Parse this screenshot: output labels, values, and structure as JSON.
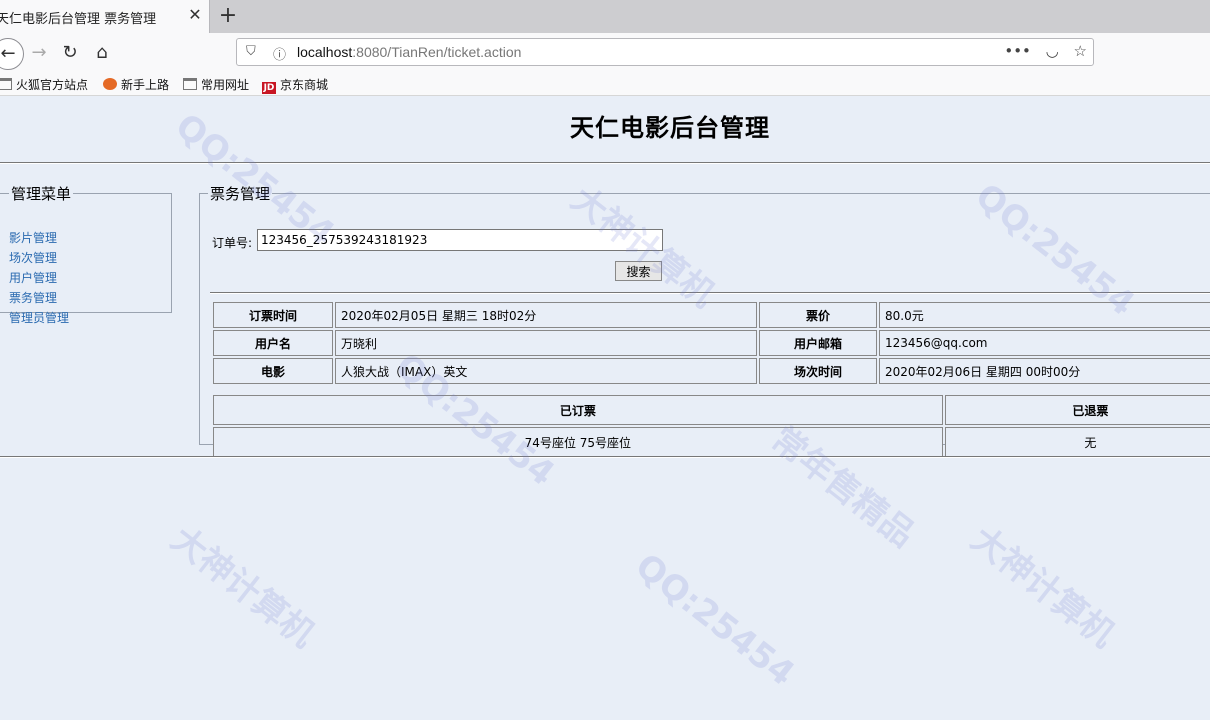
{
  "browser": {
    "tab_title": "天仁电影后台管理 票务管理",
    "tab_close": "✕",
    "new_tab": "+",
    "url_host": "localhost",
    "url_rest": ":8080/TianRen/ticket.action",
    "back": "←",
    "forward": "→",
    "reload": "↻",
    "home": "⌂",
    "more": "•••",
    "pocket": "◡",
    "star": "☆",
    "bookmarks": [
      {
        "label": "火狐官方站点",
        "icon": "folder-icon"
      },
      {
        "label": "新手上路",
        "icon": "firefox-icon"
      },
      {
        "label": "常用网址",
        "icon": "folder-icon"
      },
      {
        "label": "京东商城",
        "icon": "jd-icon"
      }
    ]
  },
  "page": {
    "title": "天仁电影后台管理"
  },
  "menu": {
    "legend": "管理菜单",
    "items": [
      "影片管理",
      "场次管理",
      "用户管理",
      "票务管理",
      "管理员管理"
    ]
  },
  "ticket": {
    "legend": "票务管理",
    "order_label": "订单号:",
    "order_value": "123456_257539243181923",
    "search_button": "搜索",
    "info": {
      "order_time_label": "订票时间",
      "order_time": "2020年02月05日 星期三 18时02分",
      "price_label": "票价",
      "price": "80.0元",
      "username_label": "用户名",
      "username": "万晓利",
      "email_label": "用户邮箱",
      "email": "123456@qq.com",
      "movie_label": "电影",
      "movie": "人狼大战（IMAX）英文",
      "show_time_label": "场次时间",
      "show_time": "2020年02月06日 星期四 00时00分"
    },
    "seats": {
      "booked_label": "已订票",
      "refunded_label": "已退票",
      "booked": "74号座位 75号座位",
      "refunded": "无"
    }
  }
}
